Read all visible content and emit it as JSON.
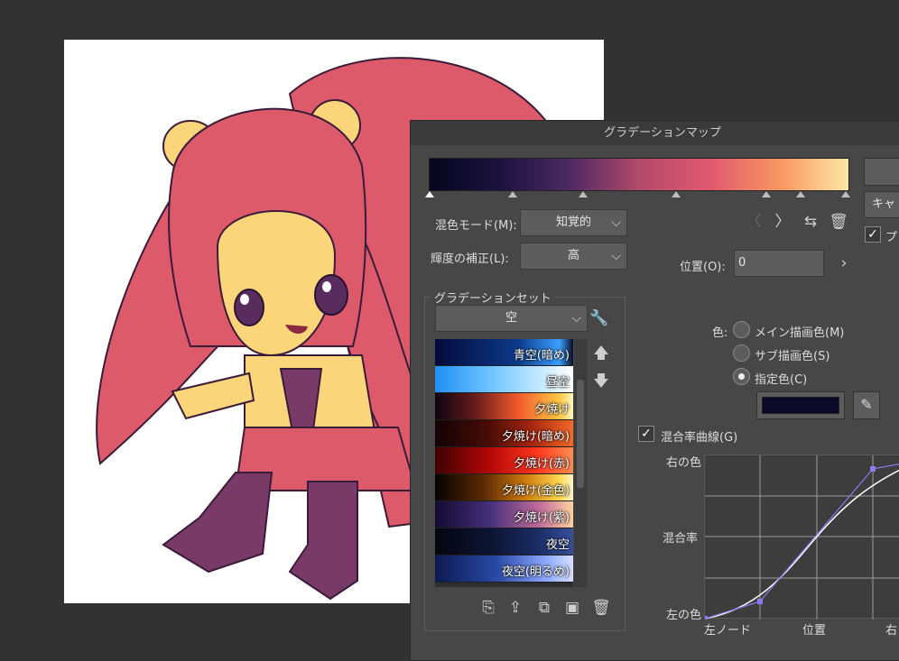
{
  "dialog": {
    "title": "グラデーションマップ",
    "ok_label": "",
    "cancel_label": "キャ",
    "preview_label": "プレ",
    "colors": {
      "panel": "#474747",
      "gradient_stops": [
        "#06061c",
        "#1c1240",
        "#4c2a62",
        "#b24a6a",
        "#e05870",
        "#f7955f",
        "#fde8a6"
      ]
    }
  },
  "blend_mode": {
    "label": "混色モード(M):",
    "value": "知覚的"
  },
  "luminance": {
    "label": "輝度の補正(L):",
    "value": "高"
  },
  "gradient_set": {
    "legend": "グラデーションセット",
    "selected": "空",
    "presets": [
      {
        "label": "青空(暗め)",
        "gradient": "linear-gradient(90deg,#050a3a,#0d3a8a 60%,#3aa0ff 90%,#0a0a20 100%)"
      },
      {
        "label": "昼空",
        "gradient": "linear-gradient(90deg,#1f8ff5,#6fc4ff 40%,#d9f2ff 85%,#ffffff)"
      },
      {
        "label": "夕焼け",
        "gradient": "linear-gradient(90deg,#0b0410,#6a1d1d 30%,#ef5a2a 60%,#ffc744 90%,#fff8c2)"
      },
      {
        "label": "夕焼け(暗め)",
        "gradient": "linear-gradient(90deg,#120205,#4a0d06 40%,#a8260f 70%,#f46a27)"
      },
      {
        "label": "夕焼け(赤)",
        "gradient": "linear-gradient(90deg,#3e0000,#b50707 40%,#ff3a20 75%,#ff8d52)"
      },
      {
        "label": "夕焼け(金色)",
        "gradient": "linear-gradient(90deg,#070201,#5a2a05 35%,#cf7a0d 65%,#ffd84d 90%,#fff5c8)"
      },
      {
        "label": "夕焼け(紫)",
        "gradient": "linear-gradient(90deg,#130a30,#45307a 40%,#c06a9a 75%,#ffd3a0)"
      },
      {
        "label": "夜空",
        "gradient": "linear-gradient(90deg,#05060f,#0c1432 40%,#1c2d66 75%,#394f9c)"
      },
      {
        "label": "夜空(明るめ)",
        "gradient": "linear-gradient(90deg,#0c1a52,#2a4aa6 45%,#8ca6ff 80%,#d6e0ff)"
      }
    ]
  },
  "node_nav": {
    "position_label": "位置(O):",
    "position_value": "0"
  },
  "color_select": {
    "label": "色:",
    "main_color": "メイン描画色(M)",
    "sub_color": "サブ描画色(S)",
    "specified_color": "指定色(C)",
    "swatch": "#0a0a28"
  },
  "curve": {
    "checkbox_label": "混合率曲線(G)",
    "y_top": "右の色",
    "y_mid": "混合率",
    "y_bottom": "左の色",
    "x_left": "左ノード",
    "x_mid": "位置",
    "x_right": "右ノ"
  }
}
